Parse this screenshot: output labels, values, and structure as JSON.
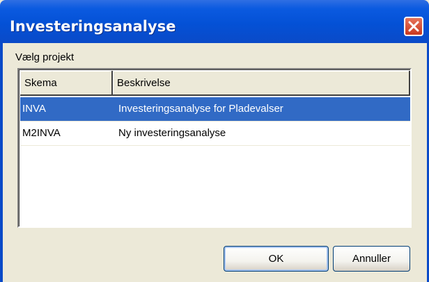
{
  "window": {
    "title": "Investeringsanalyse"
  },
  "group_label": "Vælg projekt",
  "table": {
    "columns": [
      "Skema",
      "Beskrivelse"
    ],
    "rows": [
      {
        "skema": "INVA",
        "beskrivelse": "Investeringsanalyse for Pladevalser",
        "selected": true
      },
      {
        "skema": "M2INVA",
        "beskrivelse": "Ny investeringsanalyse",
        "selected": false
      }
    ]
  },
  "buttons": {
    "ok": "OK",
    "cancel": "Annuller"
  },
  "colors": {
    "title_bar": "#0451d6",
    "selection": "#316ac5",
    "close_button": "#d84a2f"
  },
  "icons": {
    "close": "close-icon"
  }
}
